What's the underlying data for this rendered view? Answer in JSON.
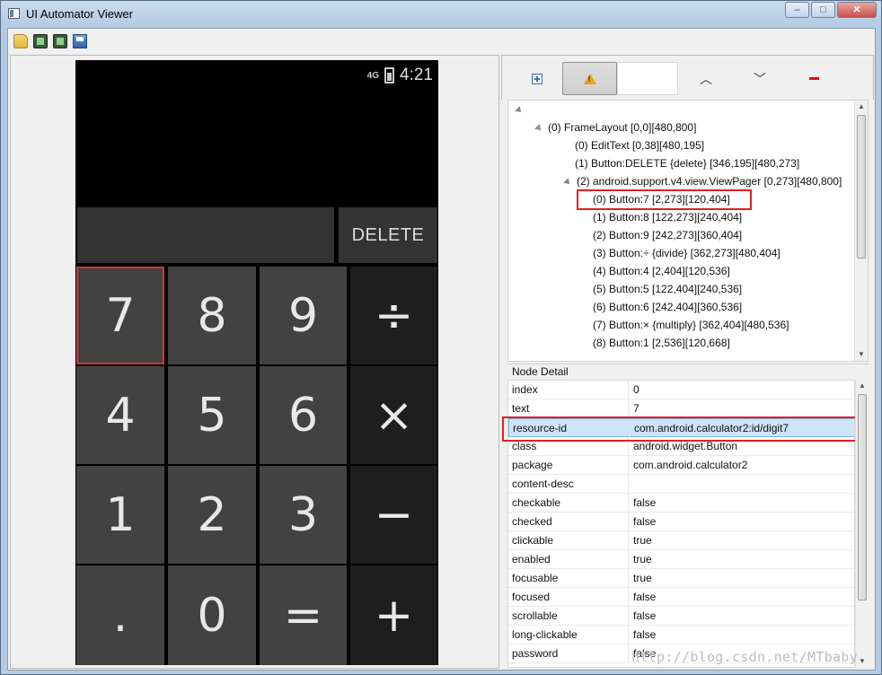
{
  "window": {
    "title": "UI Automator Viewer",
    "controls": {
      "minimize": "–",
      "maximize": "□",
      "close": "✕"
    }
  },
  "toolbar": {
    "icons": [
      "open-icon",
      "device-screenshot-icon",
      "device-screenshot-compressed-icon",
      "save-icon"
    ]
  },
  "device": {
    "status_time": "4:21",
    "network": "4G",
    "delete_label": "DELETE",
    "keys": [
      {
        "label": "7",
        "kind": "num",
        "selected": true
      },
      {
        "label": "8",
        "kind": "num"
      },
      {
        "label": "9",
        "kind": "num"
      },
      {
        "label": "÷",
        "kind": "op"
      },
      {
        "label": "4",
        "kind": "num"
      },
      {
        "label": "5",
        "kind": "num"
      },
      {
        "label": "6",
        "kind": "num"
      },
      {
        "label": "×",
        "kind": "op"
      },
      {
        "label": "1",
        "kind": "num"
      },
      {
        "label": "2",
        "kind": "num"
      },
      {
        "label": "3",
        "kind": "num"
      },
      {
        "label": "−",
        "kind": "op"
      },
      {
        "label": ".",
        "kind": "num"
      },
      {
        "label": "0",
        "kind": "num"
      },
      {
        "label": "=",
        "kind": "num"
      },
      {
        "label": "+",
        "kind": "op"
      }
    ]
  },
  "right_toolbar": {
    "buttons": [
      "expand-all-icon",
      "warning-icon",
      "blank",
      "up-chevron-icon",
      "down-chevron-icon",
      "minus-icon"
    ],
    "up_label": "^",
    "down_label": "v"
  },
  "tree": {
    "rows": [
      {
        "text": "",
        "indent": 0,
        "expander": true
      },
      {
        "text": "(0) FrameLayout [0,0][480,800]",
        "indent": 1,
        "expander": true
      },
      {
        "text": "(0) EditText [0,38][480,195]",
        "indent": 2,
        "expander": false
      },
      {
        "text": "(1) Button:DELETE {delete} [346,195][480,273]",
        "indent": 2,
        "expander": false
      },
      {
        "text": "(2) android.support.v4.view.ViewPager [0,273][480,800]",
        "indent": 2,
        "expander": true
      },
      {
        "text": "(0) Button:7 [2,273][120,404]",
        "indent": 3,
        "expander": false,
        "selected": true
      },
      {
        "text": "(1) Button:8 [122,273][240,404]",
        "indent": 3,
        "expander": false
      },
      {
        "text": "(2) Button:9 [242,273][360,404]",
        "indent": 3,
        "expander": false
      },
      {
        "text": "(3) Button:÷ {divide} [362,273][480,404]",
        "indent": 3,
        "expander": false
      },
      {
        "text": "(4) Button:4 [2,404][120,536]",
        "indent": 3,
        "expander": false
      },
      {
        "text": "(5) Button:5 [122,404][240,536]",
        "indent": 3,
        "expander": false
      },
      {
        "text": "(6) Button:6 [242,404][360,536]",
        "indent": 3,
        "expander": false
      },
      {
        "text": "(7) Button:× {multiply} [362,404][480,536]",
        "indent": 3,
        "expander": false
      },
      {
        "text": "(8) Button:1 [2,536][120,668]",
        "indent": 3,
        "expander": false
      }
    ]
  },
  "detail": {
    "title": "Node Detail",
    "rows": [
      {
        "key": "index",
        "value": "0"
      },
      {
        "key": "text",
        "value": "7"
      },
      {
        "key": "resource-id",
        "value": "com.android.calculator2:id/digit7",
        "selected": true
      },
      {
        "key": "class",
        "value": "android.widget.Button"
      },
      {
        "key": "package",
        "value": "com.android.calculator2"
      },
      {
        "key": "content-desc",
        "value": ""
      },
      {
        "key": "checkable",
        "value": "false"
      },
      {
        "key": "checked",
        "value": "false"
      },
      {
        "key": "clickable",
        "value": "true"
      },
      {
        "key": "enabled",
        "value": "true"
      },
      {
        "key": "focusable",
        "value": "true"
      },
      {
        "key": "focused",
        "value": "false"
      },
      {
        "key": "scrollable",
        "value": "false"
      },
      {
        "key": "long-clickable",
        "value": "false"
      },
      {
        "key": "password",
        "value": "false"
      }
    ]
  },
  "watermark": "http://blog.csdn.net/MTbaby"
}
